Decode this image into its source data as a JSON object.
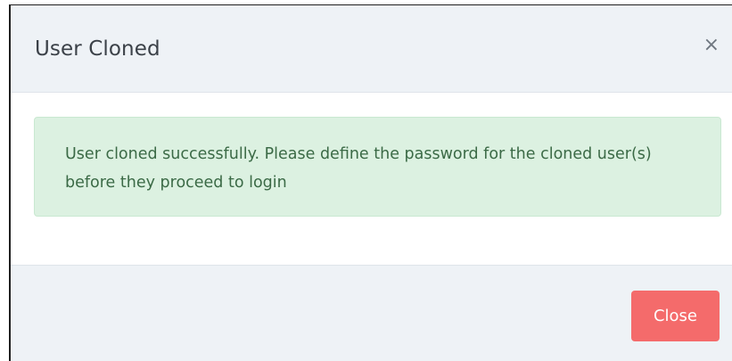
{
  "modal": {
    "title": "User Cloned",
    "close_icon_glyph": "×",
    "alert_message": "User cloned successfully. Please define the password for the cloned user(s) before they proceed to login",
    "close_button_label": "Close"
  },
  "colors": {
    "header_bg": "#eef2f6",
    "alert_bg": "#dcf1e1",
    "alert_text": "#3b6a46",
    "close_button_bg": "#f46b6b"
  },
  "icons": {
    "close": "close-icon"
  }
}
